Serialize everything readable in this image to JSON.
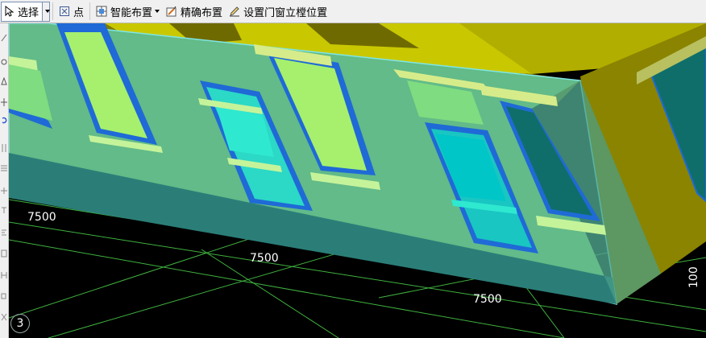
{
  "toolbar": {
    "select_label": "选择",
    "point_label": "点",
    "smart_layout_label": "智能布置",
    "precise_layout_label": "精确布置",
    "set_sill_label": "设置门窗立樘位置"
  },
  "viewport": {
    "dimensions": [
      "7500",
      "7500",
      "7500"
    ],
    "side_dimension": "100",
    "view_badge": "3"
  },
  "colors": {
    "wall_front": "#5db57f",
    "wall_base": "#2b7e78",
    "wall_top": "#7f7a00",
    "roof": "#c8c800",
    "window_frame": "#1f6ad6",
    "window_glass": "#2fd1c0",
    "grid_line": "#3fb13f"
  }
}
